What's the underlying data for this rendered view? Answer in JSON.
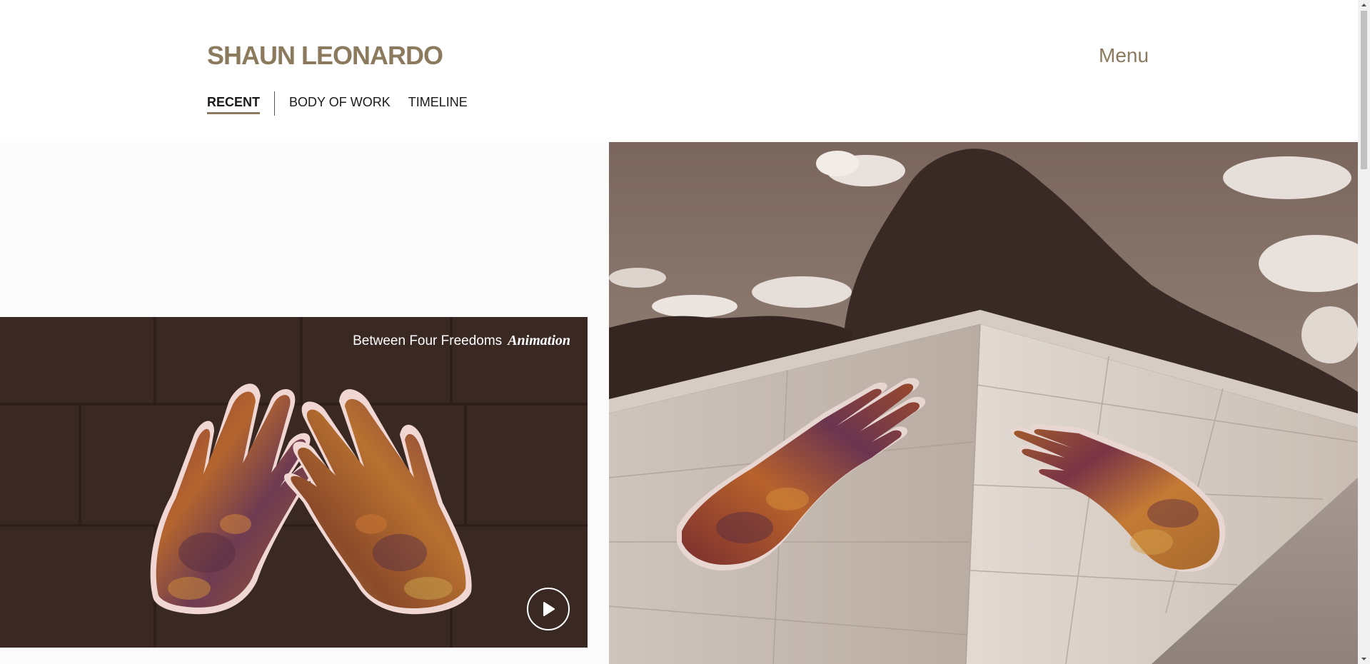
{
  "header": {
    "logo": "SHAUN LEONARDO",
    "menu_label": "Menu"
  },
  "subnav": {
    "items": [
      {
        "label": "RECENT",
        "active": true
      },
      {
        "label": "BODY OF WORK",
        "active": false
      },
      {
        "label": "TIMELINE",
        "active": false
      }
    ]
  },
  "feature_card": {
    "title": "Between Four Freedoms",
    "title_italic": "Animation",
    "play_icon": "play-icon"
  },
  "colors": {
    "brand": "#8b7a5e",
    "card_bg": "#3a2823",
    "text": "#1a1a1a"
  }
}
